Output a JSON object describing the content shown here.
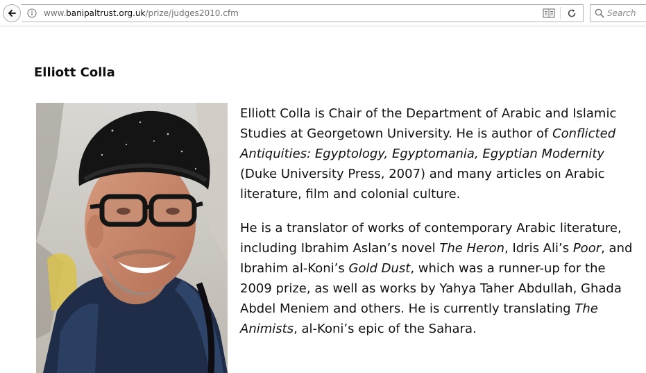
{
  "browser": {
    "url_prefix": "www.",
    "url_domain": "banipaltrust.org.uk",
    "url_path": "/prize/judges2010.cfm",
    "search_placeholder": "Search",
    "icons": {
      "back": "arrow-left-icon",
      "info": "info-icon",
      "reader": "reader-view-icon",
      "reload": "reload-icon",
      "search": "search-icon"
    }
  },
  "judge": {
    "name": "Elliott Colla",
    "photo_alt": "Elliott Colla",
    "bio_p1": {
      "t1": "Elliott Colla is Chair of the Department of Arabic and Islamic Studies at Georgetown University. He is author of ",
      "i1": "Conflicted Antiquities: Egyptology, Egyptomania, Egyptian Modernity",
      "t2": " (Duke University Press, 2007) and many articles on Arabic literature, film and colonial culture."
    },
    "bio_p2": {
      "t1": "He is a translator of works of contemporary Arabic literature, including Ibrahim Aslan’s novel ",
      "i1": "The Heron",
      "t2": ", Idris Ali’s ",
      "i2": "Poor",
      "t3": ", and Ibrahim al-Koni’s ",
      "i3": "Gold Dust",
      "t4": ", which was a runner-up for the 2009 prize, as well as works by Yahya Taher Abdullah, Ghada Abdel Meniem and others. He is currently translating ",
      "i4": "The Animists",
      "t5": ", al-Koni’s epic of the Sahara."
    }
  },
  "colors": {
    "toolbar_border": "#d7d7db",
    "url_muted": "#737373",
    "text": "#111111"
  }
}
